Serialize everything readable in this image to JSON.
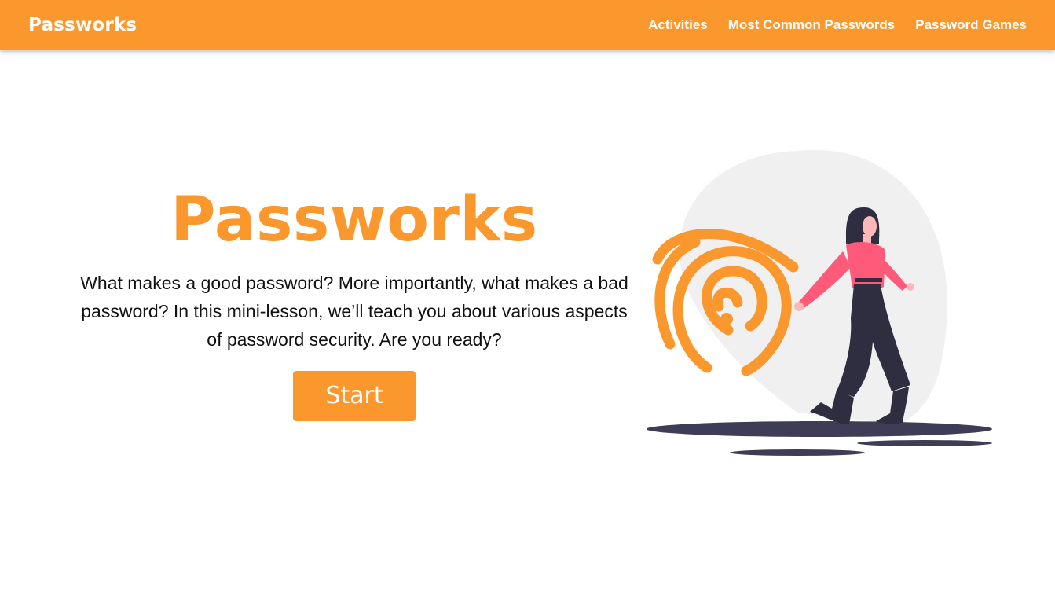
{
  "nav": {
    "brand": "Passworks",
    "links": [
      "Activities",
      "Most Common Passwords",
      "Password Games"
    ]
  },
  "hero": {
    "title": "Passworks",
    "description": "What makes a good password? More importantly, what makes a bad password? In this mini-lesson, we’ll teach you about various aspects of password security. Are you ready?",
    "button_label": "Start"
  },
  "illustration": {
    "icon": "fingerprint-woman-illustration"
  },
  "colors": {
    "brand_orange": "#fa972d",
    "navbar_text": "#ffffff",
    "body_text": "#111111",
    "blob_gray": "#f0f0f0",
    "shadow_dark": "#3f3d56",
    "shirt_pink": "#ff5a7a",
    "pants_dark": "#2f2e41"
  }
}
